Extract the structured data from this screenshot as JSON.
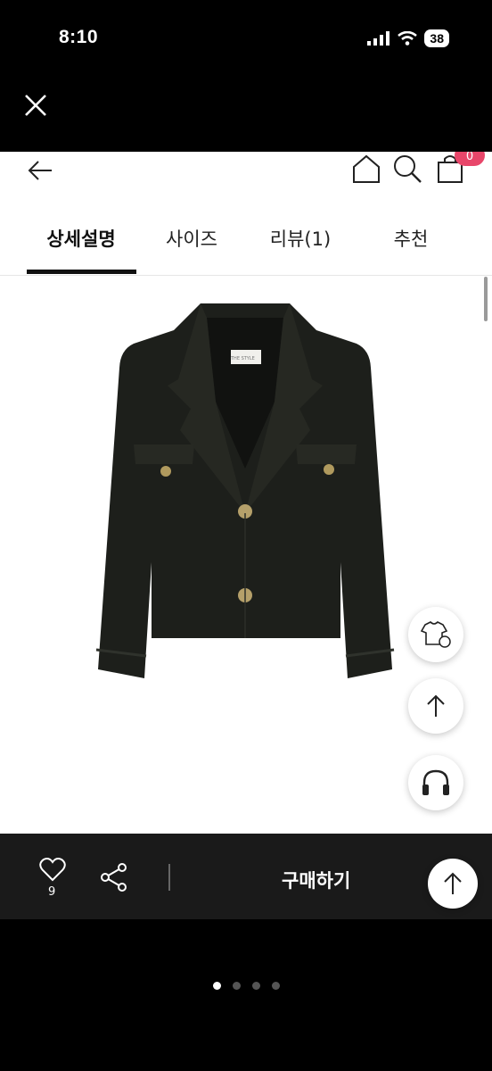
{
  "status_bar": {
    "time": "8:10",
    "battery": "38"
  },
  "tabs": [
    {
      "label": "상세설명",
      "active": true
    },
    {
      "label": "사이즈",
      "active": false
    },
    {
      "label": "리뷰(1)",
      "active": false
    },
    {
      "label": "추천",
      "active": false
    }
  ],
  "header": {
    "cart_count": "0"
  },
  "product": {
    "label_text": "THE STYLE"
  },
  "bottom_bar": {
    "like_count": "9",
    "buy_label": "구매하기"
  },
  "pager": {
    "count": 4,
    "active_index": 0
  },
  "icons": [
    "close-icon",
    "back-arrow-icon",
    "home-icon",
    "search-icon",
    "shopping-bag-icon",
    "size-guide-icon",
    "arrow-up-icon",
    "headset-icon",
    "heart-icon",
    "share-icon"
  ],
  "colors": {
    "accent_badge": "#e8466a",
    "bottom_bar": "#1a1a1a"
  }
}
